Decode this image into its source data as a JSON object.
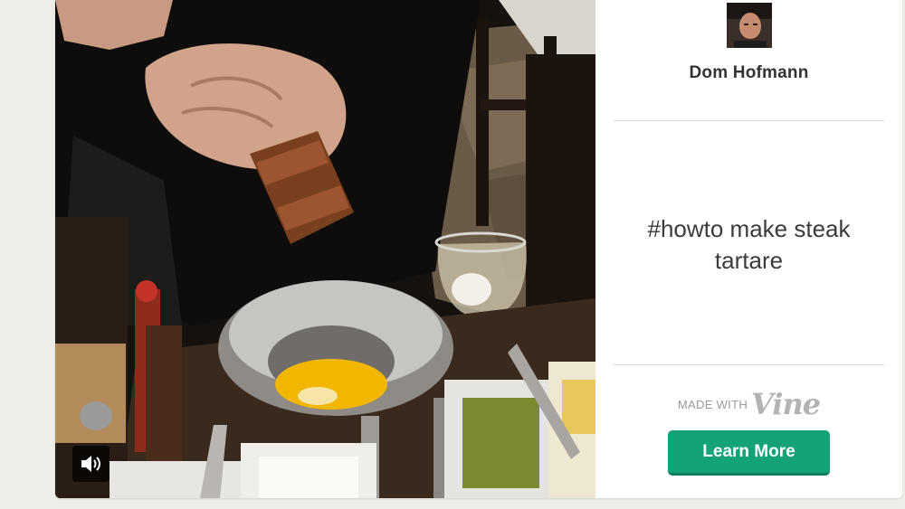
{
  "video": {
    "sound_icon": "speaker-volume-icon"
  },
  "author": {
    "name": "Dom Hofmann",
    "avatar_icon": "avatar-portrait"
  },
  "post": {
    "caption": "#howto make steak tartare"
  },
  "branding": {
    "made_with": "MADE WITH",
    "logo_text": "Vine"
  },
  "cta": {
    "label": "Learn More",
    "color": "#13a377"
  },
  "colors": {
    "page_background": "#eeeee9",
    "card_background": "#ffffff",
    "divider": "#d9d9d9"
  }
}
